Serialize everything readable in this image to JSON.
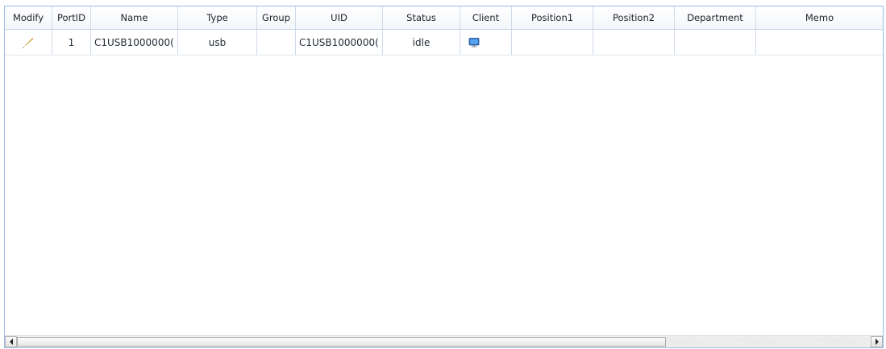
{
  "grid": {
    "columns": [
      "Modify",
      "PortID",
      "Name",
      "Type",
      "Group",
      "UID",
      "Status",
      "Client",
      "Position1",
      "Position2",
      "Department",
      "Memo"
    ],
    "rows": [
      {
        "modify_icon": "pencil-icon",
        "port_id": "1",
        "name": "C1USB1000000(",
        "type": "usb",
        "group": "",
        "uid": "C1USB1000000(",
        "status": "idle",
        "client_icon": "monitor-icon",
        "position1": "",
        "position2": "",
        "department": "",
        "memo": ""
      }
    ]
  },
  "colors": {
    "border": "#99bbe8",
    "accent_blue": "#3a78c8"
  }
}
